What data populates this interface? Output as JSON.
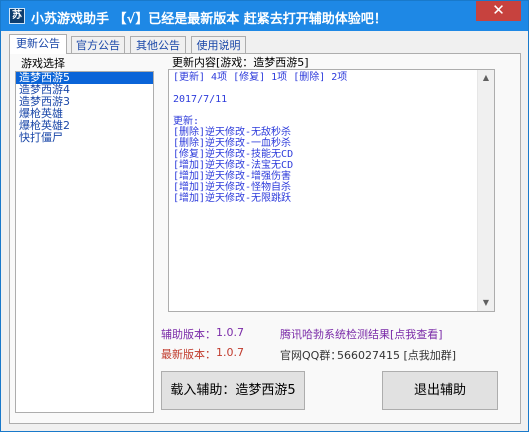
{
  "window": {
    "title": "小苏游戏助手 【√】已经是最新版本 赶紧去打开辅助体验吧！",
    "icon_label": "苏",
    "close_label": "✕"
  },
  "tabs": [
    {
      "label": "更新公告",
      "active": true
    },
    {
      "label": "官方公告",
      "active": false
    },
    {
      "label": "其他公告",
      "active": false
    },
    {
      "label": "使用说明",
      "active": false
    }
  ],
  "game_list": {
    "title": "游戏选择",
    "items": [
      "造梦西游5",
      "造梦西游4",
      "造梦西游3",
      "爆枪英雄",
      "爆枪英雄2",
      "快打僵尸"
    ],
    "selected_index": 0
  },
  "update_box": {
    "title": "更新内容[游戏：造梦西游5]",
    "text": "[更新] 4项 [修复] 1项 [删除] 2项\n\n2017/7/11\n\n更新:\n[删除]逆天修改-无敌秒杀\n[删除]逆天修改-一血秒杀\n[修复]逆天修改-技能无CD\n[增加]逆天修改-法宝无CD\n[增加]逆天修改-增强伤害\n[增加]逆天修改-怪物自杀\n[增加]逆天修改-无限跳跃"
  },
  "version": {
    "current_label": "辅助版本：",
    "current_value": "1.0.7",
    "latest_label": "最新版本：",
    "latest_value": "1.0.7",
    "colors": {
      "current": "#7a2aa8",
      "latest": "#c0392b"
    }
  },
  "links": {
    "tencent_check": "腾讯哈勃系统检测结果[点我查看]",
    "qq_group_label": "官网QQ群：",
    "qq_group_value": "566027415 [点我加群]"
  },
  "buttons": {
    "load": "载入辅助：造梦西游5",
    "exit": "退出辅助"
  },
  "icons": {
    "app": "app-icon",
    "close": "close-icon",
    "scroll_up": "scroll-up-arrow-icon",
    "scroll_down": "scroll-down-arrow-icon"
  }
}
